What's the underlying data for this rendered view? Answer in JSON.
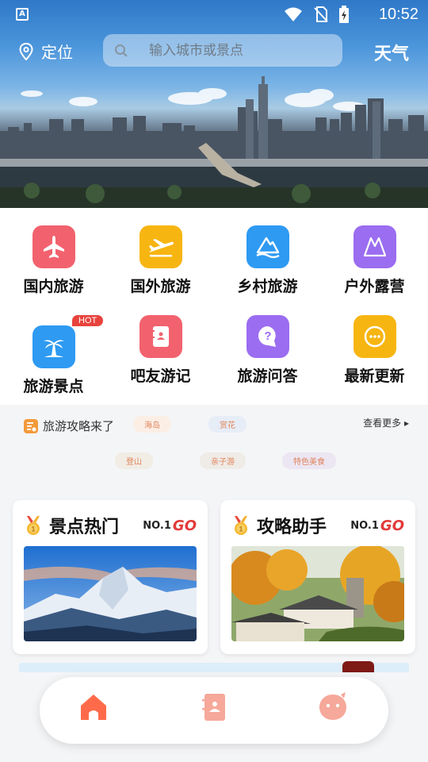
{
  "statusbar": {
    "time": "10:52"
  },
  "topbar": {
    "location_label": "定位",
    "search_placeholder": "输入城市或景点",
    "weather_label": "天气"
  },
  "categories": [
    {
      "label": "国内旅游",
      "icon": "airplane-icon",
      "color": "#f2626e"
    },
    {
      "label": "国外旅游",
      "icon": "plane-takeoff-icon",
      "color": "#f7b512"
    },
    {
      "label": "乡村旅游",
      "icon": "mountain-icon",
      "color": "#2e9af2"
    },
    {
      "label": "户外露营",
      "icon": "tent-icon",
      "color": "#9b6df0"
    },
    {
      "label": "旅游景点",
      "icon": "palm-tree-icon",
      "color": "#2e9af2",
      "badge": "HOT"
    },
    {
      "label": "吧友游记",
      "icon": "notebook-icon",
      "color": "#f2626e"
    },
    {
      "label": "旅游问答",
      "icon": "question-icon",
      "color": "#9b6df0"
    },
    {
      "label": "最新更新",
      "icon": "more-icon",
      "color": "#f7b512"
    }
  ],
  "tags": {
    "title": "旅游攻略来了",
    "more_label": "查看更多 ▸",
    "chips": [
      "海岛",
      "赏花",
      "登山",
      "亲子游",
      "特色美食"
    ]
  },
  "cards": [
    {
      "title": "景点热门",
      "rank": "NO.1",
      "go": "GO",
      "image": "snow-mountain"
    },
    {
      "title": "攻略助手",
      "rank": "NO.1",
      "go": "GO",
      "image": "autumn-village"
    }
  ],
  "bottom_nav": [
    {
      "name": "home",
      "icon": "home-icon",
      "active": true
    },
    {
      "name": "notes",
      "icon": "notebook-icon",
      "active": false
    },
    {
      "name": "profile",
      "icon": "face-icon",
      "active": false
    }
  ],
  "colors": {
    "accent": "#ff6b4a",
    "hot": "#e8433d"
  }
}
